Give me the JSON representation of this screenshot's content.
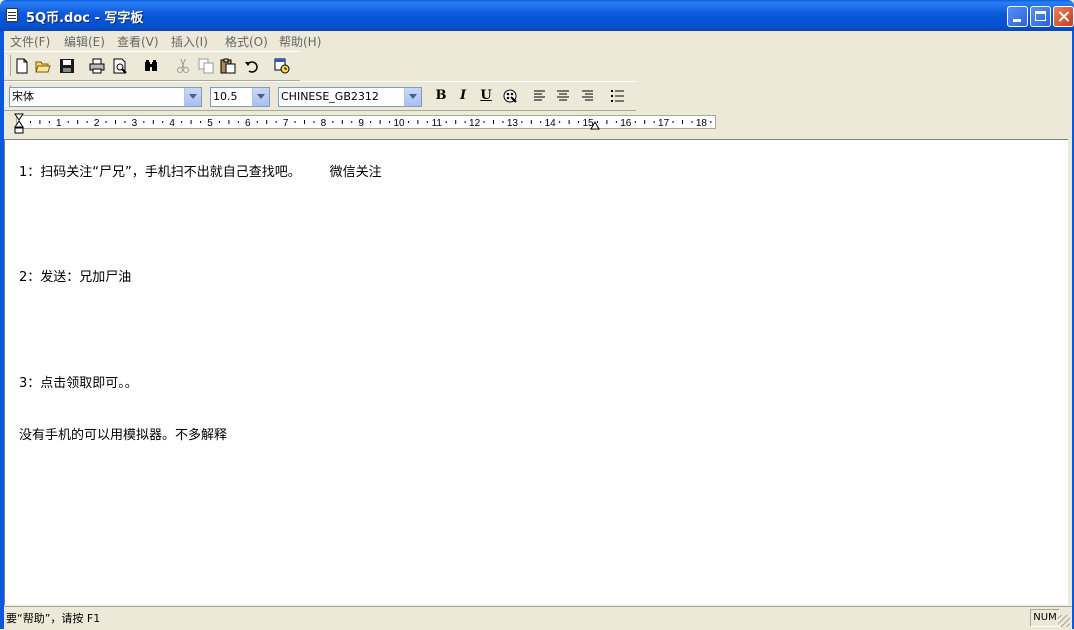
{
  "window": {
    "title": "5Q币.doc - 写字板",
    "icon": "wordpad-doc-icon"
  },
  "menu": [
    "文件(F)",
    "编辑(E)",
    "查看(V)",
    "插入(I)",
    "格式(O)",
    "帮助(H)"
  ],
  "toolbar": {
    "icons": [
      "new-icon",
      "open-icon",
      "save-icon",
      "print-icon",
      "print-preview-icon",
      "find-icon",
      "cut-icon",
      "copy-icon",
      "paste-icon",
      "undo-icon",
      "datetime-icon"
    ]
  },
  "format_bar": {
    "font": "宋体",
    "size": "10.5",
    "script": "CHINESE_GB2312",
    "bold": "B",
    "italic": "I",
    "underline": "U"
  },
  "ruler": {
    "labels": [
      "1",
      "2",
      "3",
      "4",
      "5",
      "6",
      "7",
      "8",
      "9",
      "10",
      "11",
      "12",
      "13",
      "14",
      "15",
      "16",
      "17",
      "18"
    ]
  },
  "document": {
    "lines": [
      "1：扫码关注“尸兄”，手机扫不出就自己查找吧。       微信关注",
      "2：发送：兄加尸油",
      "3：点击领取即可。。",
      "没有手机的可以用模拟器。不多解释"
    ]
  },
  "status": {
    "text": "要“帮助”，请按 F1",
    "num": "NUM"
  }
}
